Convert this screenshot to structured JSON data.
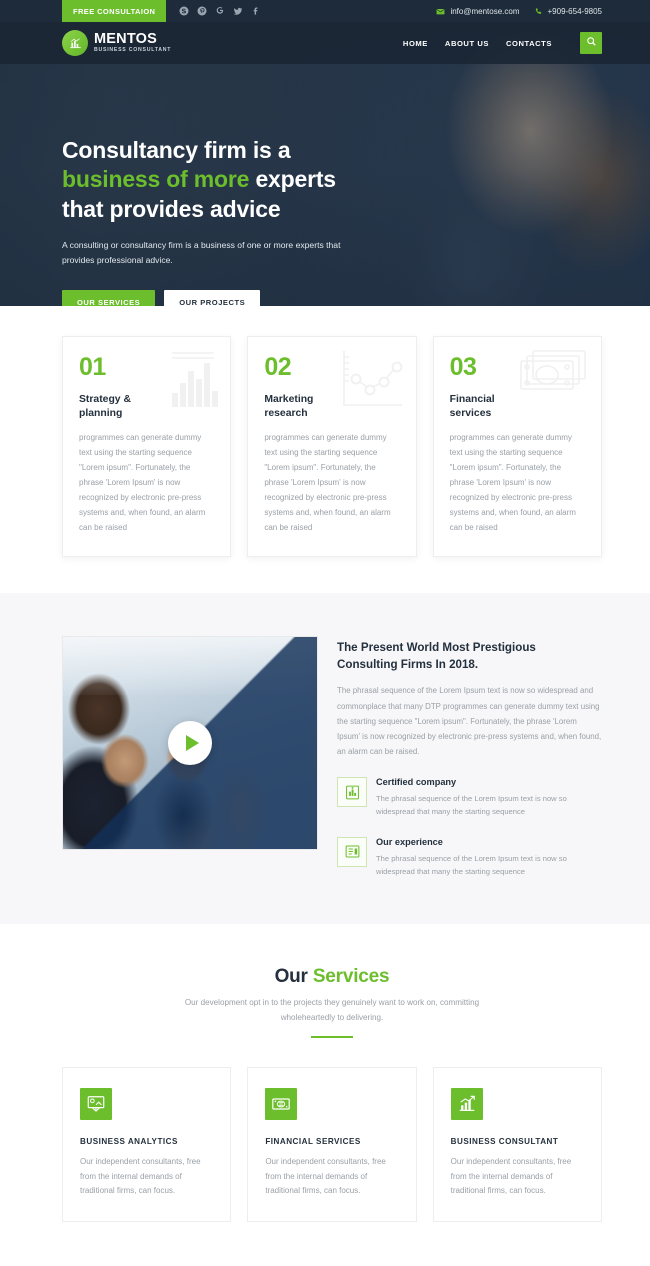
{
  "topbar": {
    "consultation_label": "FREE CONSULTAION",
    "social": [
      {
        "name": "skype-icon",
        "label": "Skype"
      },
      {
        "name": "pinterest-icon",
        "label": "Pinterest"
      },
      {
        "name": "google-plus-icon",
        "label": "Google Plus"
      },
      {
        "name": "twitter-icon",
        "label": "Twitter"
      },
      {
        "name": "facebook-icon",
        "label": "Facebook"
      }
    ],
    "email": "info@mentose.com",
    "phone": "+909-654-9805",
    "email_icon": "envelope-icon",
    "phone_icon": "phone-icon"
  },
  "nav": {
    "brand_name": "MENTOS",
    "brand_sub": "BUSINESS CONSULTANT",
    "logo_icon": "chart-bars-icon",
    "links": [
      {
        "label": "HOME"
      },
      {
        "label": "ABOUT US"
      },
      {
        "label": "CONTACTS"
      }
    ],
    "search_icon": "search-icon"
  },
  "hero": {
    "title_line1": "Consultancy firm is a",
    "title_accent": "business of more",
    "title_line2_rest": " experts",
    "title_line3": "that provides advice",
    "subtitle": "A consulting or consultancy firm is a business of one or more experts that provides professional advice.",
    "btn_primary": "OUR SERVICES",
    "btn_secondary": "OUR PROJECTS"
  },
  "features": [
    {
      "number": "01",
      "title": "Strategy &\nplanning",
      "icon": "bar-chart-icon",
      "text": "programmes can generate dummy text using the starting sequence \"Lorem ipsum\". Fortunately, the phrase 'Lorem Ipsum' is now recognized by electronic pre-press systems and, when found, an alarm can be raised"
    },
    {
      "number": "02",
      "title": "Marketing\nresearch",
      "icon": "line-graph-nodes-icon",
      "text": "programmes can generate dummy text using the starting sequence \"Lorem ipsum\". Fortunately, the phrase 'Lorem Ipsum' is now recognized by electronic pre-press systems and, when found, an alarm can be raised"
    },
    {
      "number": "03",
      "title": "Financial\nservices",
      "icon": "banknotes-icon",
      "text": "programmes can generate dummy text using the starting sequence \"Lorem ipsum\". Fortunately, the phrase 'Lorem Ipsum' is now recognized by electronic pre-press systems and, when found, an alarm can be raised"
    }
  ],
  "about": {
    "video_icon": "play-icon",
    "title": "The Present World Most Prestigious Consulting Firms In 2018.",
    "text": "The phrasal sequence of the Lorem Ipsum text is now so widespread and commonplace that many DTP programmes can generate dummy text using the starting sequence \"Lorem ipsum\". Fortunately, the phrase 'Lorem Ipsum' is now recognized by electronic pre-press systems and, when found, an alarm can be raised.",
    "features": [
      {
        "icon": "certificate-chart-icon",
        "title": "Certified company",
        "text": "The phrasal sequence of the Lorem Ipsum text is now so widespread that many the starting sequence"
      },
      {
        "icon": "document-list-icon",
        "title": "Our experience",
        "text": "The phrasal sequence of the Lorem Ipsum text is now so widespread that many the starting sequence"
      }
    ]
  },
  "services": {
    "title_plain": "Our ",
    "title_accent": "Services",
    "subtitle": "Our development opt in to the projects they genuinely want to work on, committing wholeheartedly to delivering.",
    "cards": [
      {
        "icon": "presentation-analytics-icon",
        "title": "BUSINESS ANALYTICS",
        "text": "Our independent consultants, free from the internal demands of traditional firms, can focus."
      },
      {
        "icon": "money-bill-icon",
        "title": "FINANCIAL SERVICES",
        "text": "Our independent consultants, free from the internal demands of traditional firms, can focus."
      },
      {
        "icon": "growth-chart-icon",
        "title": "BUSINESS CONSULTANT",
        "text": "Our independent consultants, free from the internal demands of traditional firms, can focus."
      }
    ]
  },
  "colors": {
    "accent_green": "#6cbe2c",
    "dark_navy": "#1d2b3a",
    "heading": "#24303d",
    "body_text": "#9aa0a6",
    "section_bg": "#f7f7f9",
    "overlay_blue": "#123058"
  }
}
